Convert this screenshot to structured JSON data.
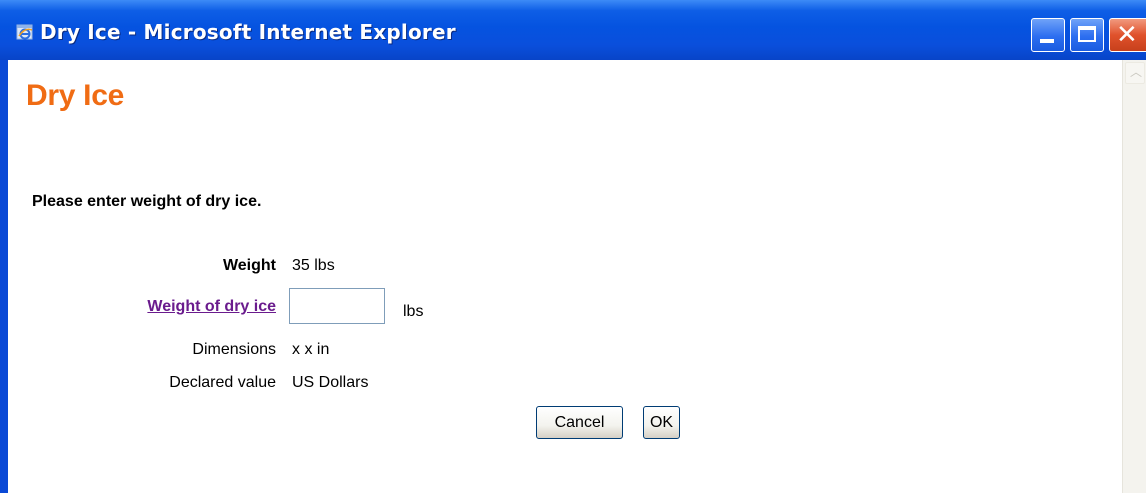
{
  "window": {
    "title": "Dry Ice - Microsoft Internet Explorer",
    "icon": "ie-icon",
    "controls": {
      "minimize_icon": "minimize-icon",
      "maximize_icon": "maximize-icon",
      "close_glyph": "✕"
    }
  },
  "page": {
    "heading": "Dry Ice",
    "instruction": "Please enter weight of dry ice."
  },
  "form": {
    "weight_label": "Weight",
    "weight_value": "35  lbs",
    "dry_ice_label": "Weight of dry ice",
    "dry_ice_value": "",
    "dry_ice_unit": "lbs",
    "dimensions_label": "Dimensions",
    "dimensions_value": "x   x  in",
    "declared_label": "Declared value",
    "declared_value": "US Dollars"
  },
  "buttons": {
    "cancel": "Cancel",
    "ok": "OK"
  },
  "colors": {
    "titlebar": "#0553e0",
    "heading": "#f06c14",
    "link": "#6a1b8d"
  }
}
